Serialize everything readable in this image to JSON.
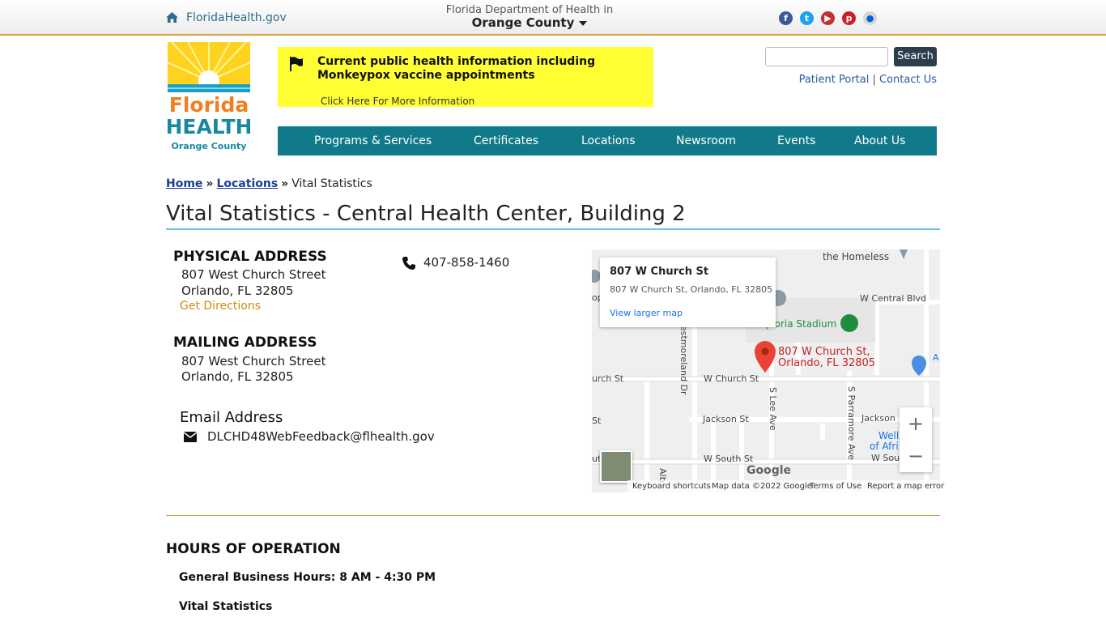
{
  "topbar": {
    "site_link": "FloridaHealth.gov",
    "dept_line": "Florida Department of Health in",
    "county": "Orange County",
    "social_icons": [
      "facebook-icon",
      "twitter-icon",
      "youtube-icon",
      "pinterest-icon",
      "flickr-icon"
    ],
    "accent_color": "#e2a23b"
  },
  "logo": {
    "line1": "Florida",
    "line2": "HEALTH",
    "line3": "Orange County"
  },
  "alert": {
    "title": "Current public health information including Monkeypox vaccine appointments",
    "link": "Click Here For More Information",
    "bg_color": "#ffff33"
  },
  "search": {
    "placeholder": "",
    "button": "Search"
  },
  "util": {
    "patient_portal": "Patient Portal",
    "sep": "|",
    "contact": "Contact Us"
  },
  "nav": {
    "bg_color": "#107a8a",
    "items": [
      "Programs & Services",
      "Certificates",
      "Locations",
      "Newsroom",
      "Events",
      "About Us"
    ]
  },
  "breadcrumb": {
    "home": "Home",
    "locations": "Locations",
    "current": "Vital Statistics"
  },
  "page_title": "Vital Statistics - Central Health Center, Building 2",
  "physical": {
    "heading": "PHYSICAL ADDRESS",
    "line1": "807 West Church Street",
    "line2": "Orlando, FL 32805",
    "directions": "Get Directions"
  },
  "mailing": {
    "heading": "MAILING ADDRESS",
    "line1": "807 West Church Street",
    "line2": "Orlando, FL 32805"
  },
  "phone": "407-858-1460",
  "email": {
    "heading": "Email Address",
    "address": "DLCHD48WebFeedback@flhealth.gov"
  },
  "map": {
    "card_title": "807 W Church St",
    "card_address": "807 W Church St, Orlando, FL 32805",
    "card_link": "View larger map",
    "pin_label_1": "807 W Church St,",
    "pin_label_2": "Orlando, FL 32805",
    "labels": {
      "homeless": "the Homeless",
      "central": "W Central Blvd",
      "stadium": "Exploria Stadium",
      "church_left": "urch St",
      "church": "W Church St",
      "westmoreland": "estmoreland Dr",
      "lee": "S Lee Ave",
      "parramore": "S Parramore Ave",
      "jackson": "Jackson St",
      "jackson_right": "Jackson",
      "st_left": "St",
      "south": "W South St",
      "south_right": "W South",
      "south_left": "ut",
      "wells1": "Well",
      "wells2": "of Afri",
      "alb": "Alb",
      "op": "op",
      "a_right": "A"
    },
    "google": "Google",
    "footer": [
      "Keyboard shortcuts",
      "Map data ©2022 Google",
      "Terms of Use",
      "Report a map error"
    ],
    "zoom_in": "+",
    "zoom_out": "−"
  },
  "hours": {
    "heading": "HOURS OF OPERATION",
    "general": "General Business Hours: 8 AM - 4:30 PM",
    "vital": "Vital Statistics"
  }
}
